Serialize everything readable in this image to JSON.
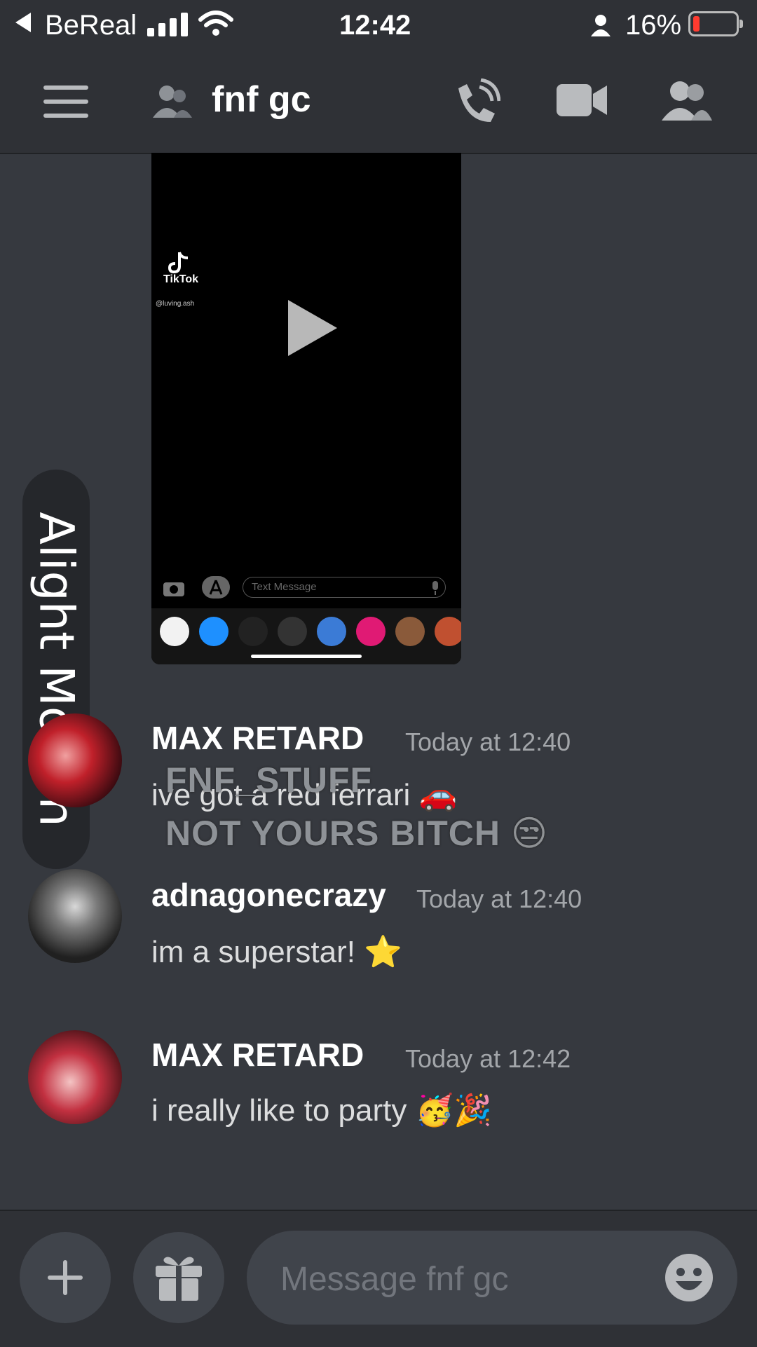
{
  "status_bar": {
    "back_app": "BeReal",
    "time": "12:42",
    "battery": "16%",
    "icons": [
      "back-arrow-icon",
      "signal-icon",
      "wifi-icon",
      "person-icon",
      "battery-icon"
    ]
  },
  "header": {
    "title": "fnf gc",
    "icons": [
      "menu-icon",
      "group-dm-icon",
      "call-icon",
      "video-icon",
      "members-icon"
    ]
  },
  "video_embed": {
    "tiktok_label": "TikTok",
    "tiktok_handle": "@luving.ash",
    "input_placeholder": "Text Message",
    "icons": [
      "play-icon",
      "tiktok-icon",
      "camera-icon",
      "appstore-icon",
      "mic-icon"
    ]
  },
  "watermark": "Alight Motion",
  "overlay": {
    "line1": "FNF_STUFF",
    "line2": "NOT YOURS BITCH"
  },
  "messages": [
    {
      "author": "MAX RETARD",
      "timestamp": "Today at 12:40",
      "text": "ive got a red ferrari",
      "emoji": "🚗"
    },
    {
      "author": "adnagonecrazy",
      "timestamp": "Today at 12:40",
      "text": "im a superstar!",
      "emoji": "⭐"
    },
    {
      "author": "MAX RETARD",
      "timestamp": "Today at 12:42",
      "text": "i really like to party",
      "emoji": "🥳🎉"
    }
  ],
  "composer": {
    "placeholder": "Message fnf gc",
    "icons": [
      "plus-icon",
      "gift-icon",
      "emoji-icon"
    ]
  },
  "colors": {
    "background": "#36393f",
    "header": "#2f3136",
    "input": "#40444b",
    "timestamp": "#a3a6aa",
    "battery_low": "#ff3b30"
  }
}
